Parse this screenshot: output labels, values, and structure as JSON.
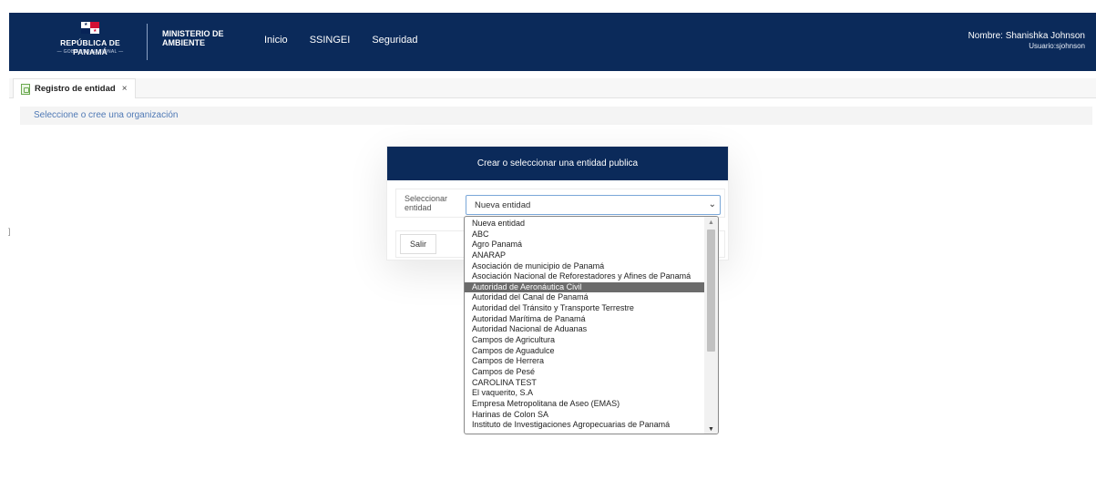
{
  "header": {
    "country": "REPÚBLICA DE PANAMÁ",
    "government": "— GOBIERNO NACIONAL —",
    "ministry_line1": "MINISTERIO DE",
    "ministry_line2": "AMBIENTE",
    "nav": [
      "Inicio",
      "SSINGEI",
      "Seguridad"
    ],
    "user_name": "Nombre: Shanishka Johnson",
    "user_id": "Usuario:sjohnson",
    "bg_color": "#0b2a5a"
  },
  "tab": {
    "label": "Registro de entidad",
    "close": "×",
    "icon": "document-icon"
  },
  "breadcrumb": "Seleccione o cree una organización",
  "side_marker": "]",
  "card": {
    "title": "Crear o seleccionar una entidad publica",
    "field_label_1": "Seleccionar",
    "field_label_2": "entidad",
    "selected": "Nueva entidad",
    "exit_label": "Salir"
  },
  "dropdown": {
    "highlighted_index": 6,
    "options": [
      "Nueva entidad",
      "ABC",
      "Agro Panamá",
      "ANARAP",
      "Asociación de municipio de Panamá",
      "Asociación Nacional de Reforestadores y Afines de Panamá",
      "Autoridad de Aeronáutica Civil",
      "Autoridad del Canal de Panamá",
      "Autoridad del Tránsito y Transporte Terrestre",
      "Autoridad Marítima de Panamá",
      "Autoridad Nacional de Aduanas",
      "Campos de Agricultura",
      "Campos de Aguadulce",
      "Campos de Herrera",
      "Campos de Pesé",
      "CAROLINA TEST",
      "El vaquerito, S.A",
      "Empresa Metropolitana de Aseo (EMAS)",
      "Harinas de Colon SA",
      "Instituto de Investigaciones Agropecuarias de Panamá"
    ]
  }
}
